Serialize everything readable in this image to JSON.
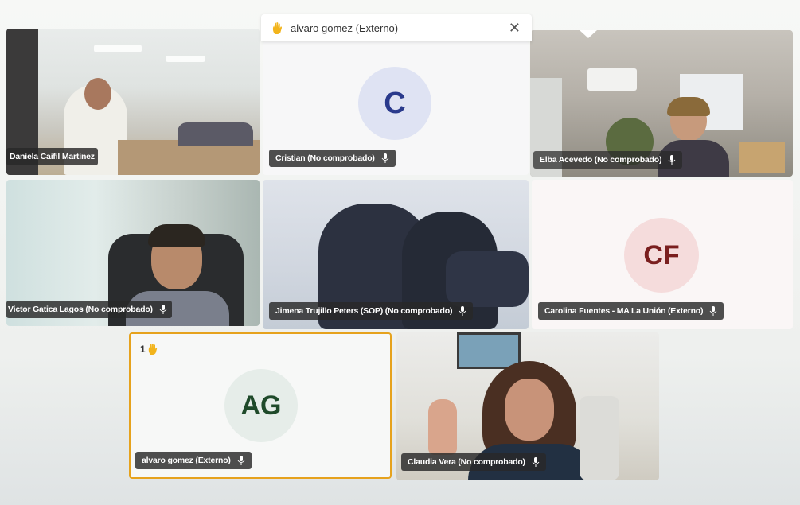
{
  "notification": {
    "text": "alvaro gomez (Externo)",
    "close_icon": "close-icon",
    "raise_hand_icon": "raised-hand-icon"
  },
  "participants": [
    {
      "label": "Daniela Caifil Martinez",
      "type": "video"
    },
    {
      "label": "Cristian (No comprobado)",
      "type": "avatar",
      "initials": "C",
      "avatar_bg": "#dfe3f3",
      "avatar_fg": "#2a3a8c"
    },
    {
      "label": "Elba Acevedo (No comprobado)",
      "type": "video"
    },
    {
      "label": "Victor Gatica Lagos (No comprobado)",
      "type": "video"
    },
    {
      "label": "Jimena Trujillo Peters (SOP) (No comprobado)",
      "type": "video"
    },
    {
      "label": "Carolina Fuentes - MA La Unión (Externo)",
      "type": "avatar",
      "initials": "CF",
      "avatar_bg": "#f5dcdc",
      "avatar_fg": "#7a1f1f"
    },
    {
      "label": "alvaro gomez (Externo)",
      "type": "avatar",
      "initials": "AG",
      "avatar_bg": "#e6ede9",
      "avatar_fg": "#1f4a2a",
      "hand_raised_order": "1",
      "highlight": "#e6a21d"
    },
    {
      "label": "Claudia Vera (No comprobado)",
      "type": "video"
    }
  ],
  "colors": {
    "label_bg": "#2b2b2b",
    "highlight_border": "#e6a21d",
    "hand_yellow": "#f2b41c"
  }
}
